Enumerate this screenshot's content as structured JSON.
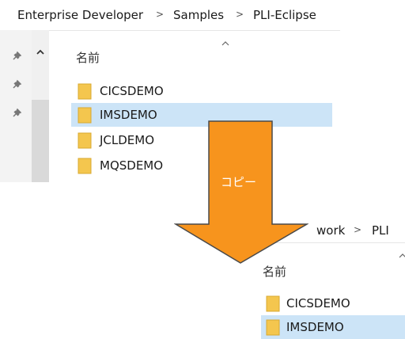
{
  "top_window": {
    "breadcrumb": [
      "Enterprise Developer",
      "Samples",
      "PLI-Eclipse"
    ],
    "column_header": "名前",
    "files": [
      {
        "name": "CICSDEMO",
        "selected": false
      },
      {
        "name": "IMSDEMO",
        "selected": true
      },
      {
        "name": "JCLDEMO",
        "selected": false
      },
      {
        "name": "MQSDEMO",
        "selected": false
      }
    ]
  },
  "bottom_window": {
    "breadcrumb": [
      "work",
      "PLI"
    ],
    "column_header": "名前",
    "files": [
      {
        "name": "CICSDEMO",
        "selected": false
      },
      {
        "name": "IMSDEMO",
        "selected": true
      }
    ]
  },
  "arrow_label": "コピー",
  "colors": {
    "arrow_fill": "#f7941d",
    "arrow_stroke": "#4a4a4a",
    "selection": "#cce4f7",
    "folder": "#f4c64e"
  }
}
